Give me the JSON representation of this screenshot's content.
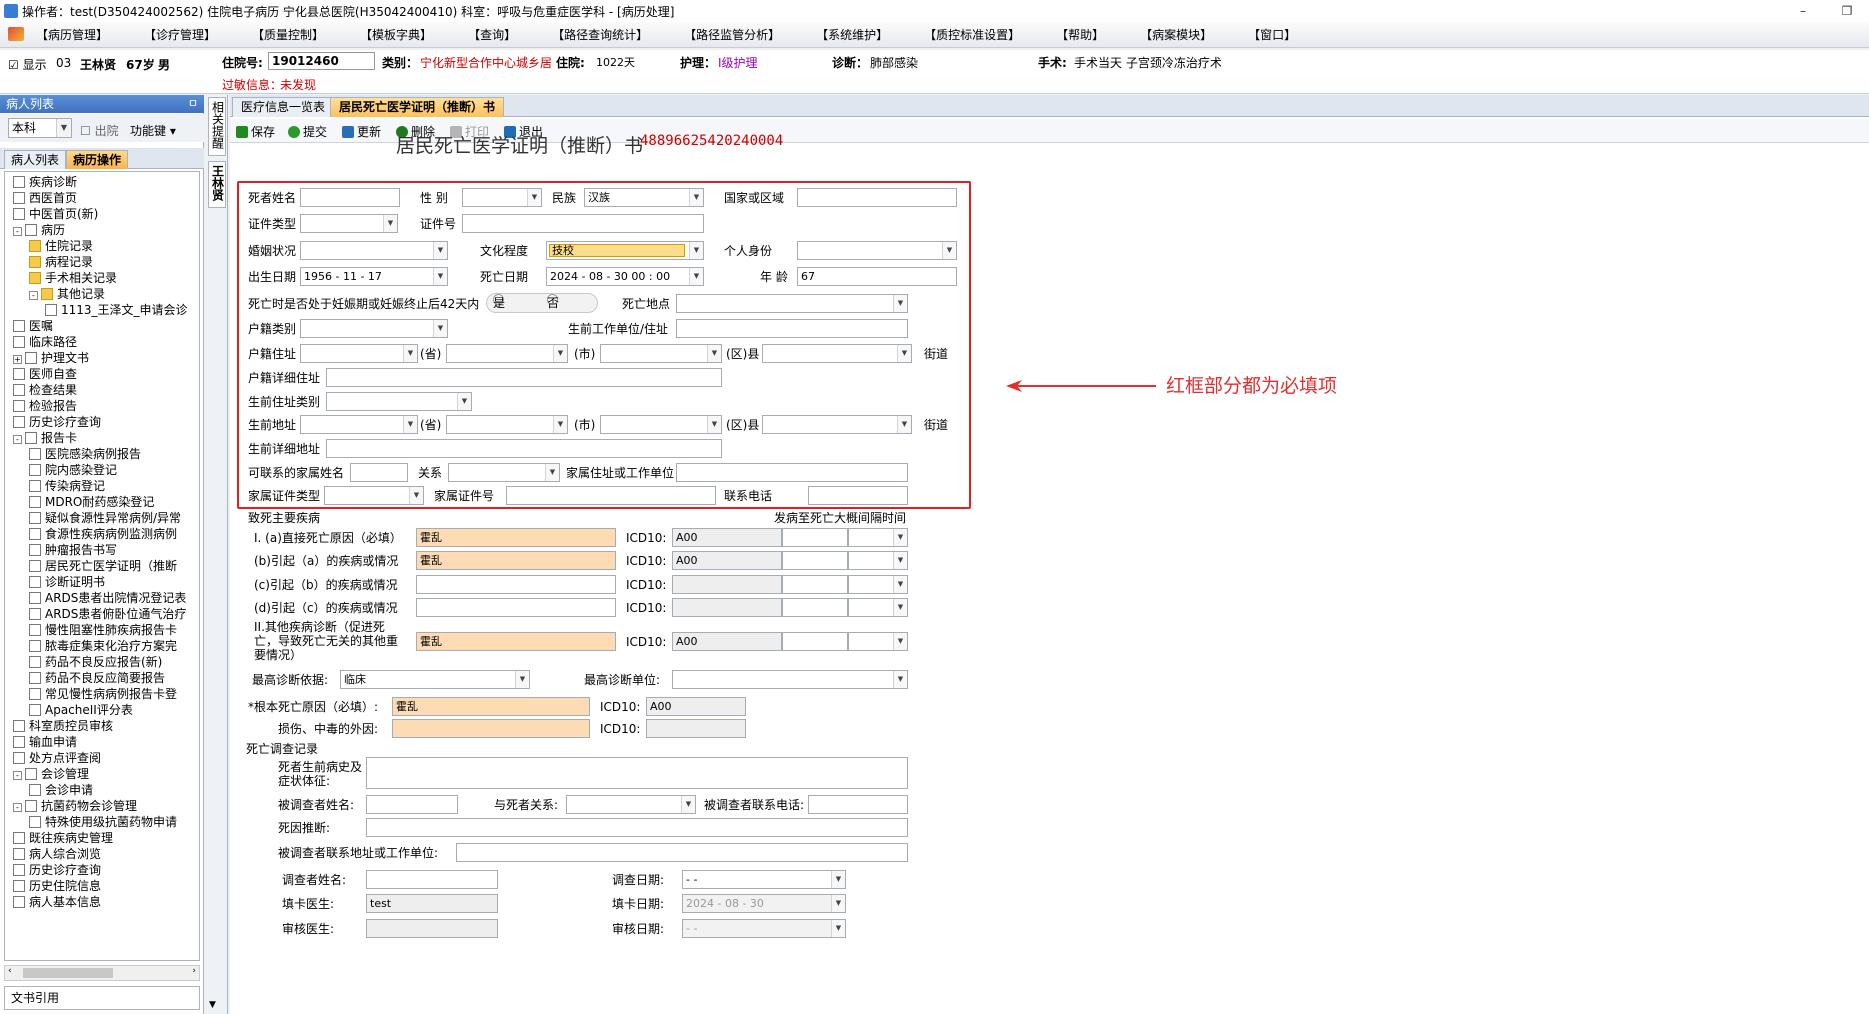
{
  "window": {
    "title": "操作者：test(D350424002562) 住院电子病历  宁化县总医院(H35042400410)  科室：呼吸与危重症医学科 - [病历处理]",
    "controls": [
      "–",
      "❐"
    ]
  },
  "menu": [
    "【病历管理】",
    "【诊疗管理】",
    "【质量控制】",
    "【模板字典】",
    "【查询】",
    "【路径查询统计】",
    "【路径监管分析】",
    "【系统维护】",
    "【质控标准设置】",
    "【帮助】",
    "【病案模块】",
    "【窗口】"
  ],
  "patient": {
    "show_label": "显示",
    "bed": "03",
    "name": "王林贤",
    "age": "67岁",
    "sex": "男",
    "admission_no_label": "住院号:",
    "admission_no": "19012460",
    "category_label": "类别：",
    "category": "宁化新型合作中心城乡居",
    "stay_label": "住院:",
    "stay": "1022天",
    "nursing_label": "护理：",
    "nursing": "Ⅰ级护理",
    "diagnosis_label": "诊断：",
    "diagnosis": "肺部感染",
    "surgery_label": "手术:",
    "surgery": "手术当天  子宫颈冷冻治疗术",
    "allergy_label": "过敏信息：",
    "allergy": "未发现"
  },
  "left_panel": {
    "title": "病人列表",
    "pin": "ㅁ",
    "dept_select": "本科",
    "discharge_label": "出院",
    "func_key": "功能键",
    "tabs": [
      "病人列表",
      "病历操作"
    ],
    "tree": [
      {
        "label": "疾病诊断",
        "level": 1,
        "icon": "doc"
      },
      {
        "label": "西医首页",
        "level": 1,
        "icon": "doc"
      },
      {
        "label": "中医首页(新)",
        "level": 1,
        "icon": "doc"
      },
      {
        "label": "病历",
        "level": 1,
        "icon": "doc",
        "expander": "-"
      },
      {
        "label": "住院记录",
        "level": 2,
        "icon": "folder"
      },
      {
        "label": "病程记录",
        "level": 2,
        "icon": "folder"
      },
      {
        "label": "手术相关记录",
        "level": 2,
        "icon": "folder"
      },
      {
        "label": "其他记录",
        "level": 2,
        "icon": "folder",
        "expander": "-"
      },
      {
        "label": "1113_王泽文_申请会诊",
        "level": 3,
        "icon": "doc"
      },
      {
        "label": "医嘱",
        "level": 1,
        "icon": "doc"
      },
      {
        "label": "临床路径",
        "level": 1,
        "icon": "doc"
      },
      {
        "label": "护理文书",
        "level": 1,
        "icon": "doc",
        "expander": "+"
      },
      {
        "label": "医师自查",
        "level": 1,
        "icon": "doc"
      },
      {
        "label": "检查结果",
        "level": 1,
        "icon": "doc"
      },
      {
        "label": "检验报告",
        "level": 1,
        "icon": "doc"
      },
      {
        "label": "历史诊疗查询",
        "level": 1,
        "icon": "doc"
      },
      {
        "label": "报告卡",
        "level": 1,
        "icon": "doc",
        "expander": "-"
      },
      {
        "label": "医院感染病例报告",
        "level": 2,
        "icon": "doc"
      },
      {
        "label": "院内感染登记",
        "level": 2,
        "icon": "doc"
      },
      {
        "label": "传染病登记",
        "level": 2,
        "icon": "doc"
      },
      {
        "label": "MDRO耐药感染登记",
        "level": 2,
        "icon": "doc"
      },
      {
        "label": "疑似食源性异常病例/异常",
        "level": 2,
        "icon": "doc"
      },
      {
        "label": "食源性疾病病例监测病例",
        "level": 2,
        "icon": "doc"
      },
      {
        "label": "肿瘤报告书写",
        "level": 2,
        "icon": "doc"
      },
      {
        "label": "居民死亡医学证明（推断",
        "level": 2,
        "icon": "doc"
      },
      {
        "label": "诊断证明书",
        "level": 2,
        "icon": "doc"
      },
      {
        "label": "ARDS患者出院情况登记表",
        "level": 2,
        "icon": "doc"
      },
      {
        "label": "ARDS患者俯卧位通气治疗",
        "level": 2,
        "icon": "doc"
      },
      {
        "label": "慢性阻塞性肺疾病报告卡",
        "level": 2,
        "icon": "doc"
      },
      {
        "label": "脓毒症集束化治疗方案完",
        "level": 2,
        "icon": "doc"
      },
      {
        "label": "药品不良反应报告(新)",
        "level": 2,
        "icon": "doc"
      },
      {
        "label": "药品不良反应简要报告",
        "level": 2,
        "icon": "doc"
      },
      {
        "label": "常见慢性病病例报告卡登",
        "level": 2,
        "icon": "doc"
      },
      {
        "label": "ApacheII评分表",
        "level": 2,
        "icon": "doc"
      },
      {
        "label": "科室质控员审核",
        "level": 1,
        "icon": "doc"
      },
      {
        "label": "输血申请",
        "level": 1,
        "icon": "doc"
      },
      {
        "label": "处方点评查阅",
        "level": 1,
        "icon": "doc"
      },
      {
        "label": "会诊管理",
        "level": 1,
        "icon": "doc",
        "expander": "-"
      },
      {
        "label": "会诊申请",
        "level": 2,
        "icon": "doc"
      },
      {
        "label": "抗菌药物会诊管理",
        "level": 1,
        "icon": "doc",
        "expander": "-"
      },
      {
        "label": "特殊使用级抗菌药物申请",
        "level": 2,
        "icon": "doc"
      },
      {
        "label": "既往疾病史管理",
        "level": 1,
        "icon": "doc"
      },
      {
        "label": "病人综合浏览",
        "level": 1,
        "icon": "doc"
      },
      {
        "label": "历史诊疗查询",
        "level": 1,
        "icon": "doc"
      },
      {
        "label": "历史住院信息",
        "level": 1,
        "icon": "doc"
      },
      {
        "label": "病人基本信息",
        "level": 1,
        "icon": "doc"
      }
    ],
    "footer": "文书引用"
  },
  "vertical_tabs": [
    "相关提醒",
    "王林贤"
  ],
  "doc_tabs": [
    "医疗信息一览表",
    "居民死亡医学证明（推断）书"
  ],
  "toolbar": [
    {
      "label": "保存",
      "icon": "save-icon",
      "color": "#1f8a1f"
    },
    {
      "label": "提交",
      "icon": "submit-icon",
      "color": "#2b9a2b"
    },
    {
      "label": "更新",
      "icon": "update-icon",
      "color": "#2a6db5"
    },
    {
      "label": "删除",
      "icon": "delete-icon",
      "color": "#1f7a1f"
    },
    {
      "label": "打印",
      "icon": "print-icon",
      "color": "#9a9a9a",
      "disabled": true
    },
    {
      "label": "退出",
      "icon": "exit-icon",
      "color": "#1f6db5"
    }
  ],
  "form": {
    "title": "居民死亡医学证明（推断）书",
    "doc_no": "48896625420240004",
    "labels": {
      "deceased_name": "死者姓名",
      "sex": "性  别",
      "ethnicity": "民族",
      "country": "国家或区域",
      "id_type": "证件类型",
      "id_no": "证件号",
      "marital": "婚姻状况",
      "education": "文化程度",
      "identity": "个人身份",
      "birth_date": "出生日期",
      "death_date": "死亡日期",
      "age": "年  龄",
      "pregnancy": "死亡时是否处于妊娠期或妊娠终止后42天内",
      "yes": "是",
      "no": "否",
      "death_place": "死亡地点",
      "household_type": "户籍类别",
      "work_unit": "生前工作单位/住址",
      "household_addr": "户籍住址",
      "province": "(省)",
      "city": "(市)",
      "county": "(区)县",
      "street": "街道",
      "household_detail": "户籍详细住址",
      "residence_type": "生前住址类别",
      "residence_addr": "生前地址",
      "residence_detail": "生前详细地址",
      "contact_name": "可联系的家属姓名",
      "relation": "关系",
      "family_addr": "家属住址或工作单位",
      "family_id_type": "家属证件类型",
      "family_id_no": "家属证件号",
      "phone": "联系电话",
      "cause_section": "致死主要疾病",
      "interval": "发病至死亡大概间隔时间",
      "cause_a": "I. (a)直接死亡原因（必填）",
      "cause_b": "(b)引起（a）的疾病或情况",
      "cause_c": "(c)引起（b）的疾病或情况",
      "cause_d": "(d)引起（c）的疾病或情况",
      "cause_other": "II.其他疾病诊断（促进死亡，导致死亡无关的其他重要情况）",
      "icd": "ICD10:",
      "highest_basis": "最高诊断依据:",
      "highest_unit": "最高诊断单位:",
      "root_cause": "*根本死亡原因（必填）:",
      "external": "损伤、中毒的外因:",
      "investigation": "死亡调查记录",
      "history": "死者生前病史及症状体征:",
      "interviewee": "被调查者姓名:",
      "interviewee_relation": "与死者关系:",
      "interviewee_phone": "被调查者联系电话:",
      "cause_inferred": "死因推断:",
      "interviewee_addr": "被调查者联系地址或工作单位:",
      "investigator": "调查者姓名:",
      "investigation_date": "调查日期:",
      "filler": "填卡医生:",
      "fill_date": "填卡日期:",
      "reviewer": "审核医生:",
      "review_date": "审核日期:"
    },
    "values": {
      "ethnicity": "汉族",
      "education": "技校",
      "birth_date": "1956 - 11 - 17",
      "death_date": "2024 - 08 - 30    00 : 00",
      "age": "67",
      "cause_a": "霍乱",
      "cause_a_icd": "A00",
      "cause_b": "霍乱",
      "cause_b_icd": "A00",
      "cause_other": "霍乱",
      "cause_other_icd": "A00",
      "highest_basis": "临床",
      "root_cause": "霍乱",
      "root_cause_icd": "A00",
      "investigation_date": "  -    -",
      "filler": "test",
      "fill_date": "2024 - 08 - 30",
      "review_date": "  -    -"
    }
  },
  "annotation": "红框部分都为必填项",
  "colors": {
    "required_border": "#e02020",
    "required_fill": "#fddcb5",
    "annotation": "#e23030"
  }
}
